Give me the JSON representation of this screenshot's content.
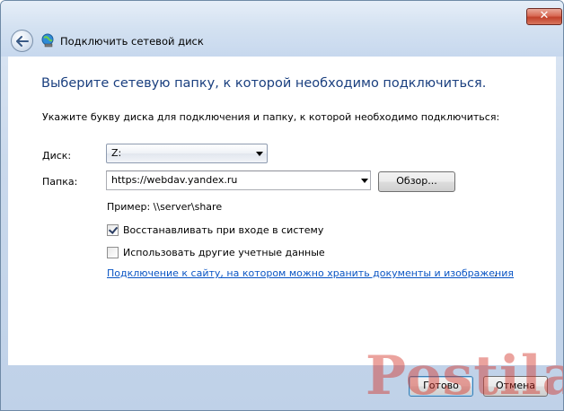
{
  "window": {
    "title": "Подключить сетевой диск",
    "close_label": "✕"
  },
  "content": {
    "heading": "Выберите сетевую папку, к которой необходимо подключиться.",
    "instruction": "Укажите букву диска для подключения и папку, к которой необходимо подключиться:",
    "drive": {
      "label": "Диск:",
      "value": "Z:"
    },
    "folder": {
      "label": "Папка:",
      "value": "https://webdav.yandex.ru",
      "browse_label": "Обзор..."
    },
    "example": "Пример: \\\\server\\share",
    "reconnect": {
      "label": "Восстанавливать при входе в систему",
      "checked": true
    },
    "other_credentials": {
      "label": "Использовать другие учетные данные",
      "checked": false
    },
    "link": "Подключение к сайту, на котором можно хранить документы и изображения",
    "link_suffix": "."
  },
  "footer": {
    "finish_label": "Готово",
    "cancel_label": "Отмена"
  },
  "watermark": "Postila.ru",
  "colors": {
    "heading": "#1a3f7f",
    "link": "#0a55c4",
    "close_button": "#c2412b"
  }
}
